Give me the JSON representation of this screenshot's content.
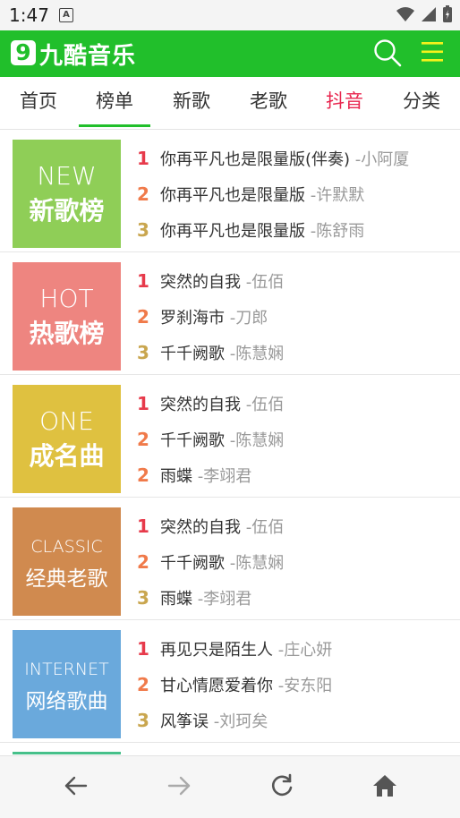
{
  "status": {
    "time": "1:47",
    "a_label": "A"
  },
  "header": {
    "logo_num": "9",
    "logo_text": "九酷音乐"
  },
  "tabs": [
    {
      "label": "首页"
    },
    {
      "label": "榜单"
    },
    {
      "label": "新歌"
    },
    {
      "label": "老歌"
    },
    {
      "label": "抖音"
    },
    {
      "label": "分类"
    }
  ],
  "charts": [
    {
      "en": "NEW",
      "cn": "新歌榜",
      "color": "#8fce57",
      "songs": [
        {
          "rank": "1",
          "title": "你再平凡也是限量版(伴奏)",
          "artist": "-小阿厦"
        },
        {
          "rank": "2",
          "title": "你再平凡也是限量版",
          "artist": "-许默默"
        },
        {
          "rank": "3",
          "title": "你再平凡也是限量版",
          "artist": "-陈舒雨"
        }
      ]
    },
    {
      "en": "HOT",
      "cn": "热歌榜",
      "color": "#ee8580",
      "songs": [
        {
          "rank": "1",
          "title": "突然的自我",
          "artist": "-伍佰"
        },
        {
          "rank": "2",
          "title": "罗刹海市",
          "artist": "-刀郎"
        },
        {
          "rank": "3",
          "title": "千千阙歌",
          "artist": "-陈慧娴"
        }
      ]
    },
    {
      "en": "ONE",
      "cn": "成名曲",
      "color": "#dfc140",
      "songs": [
        {
          "rank": "1",
          "title": "突然的自我",
          "artist": "-伍佰"
        },
        {
          "rank": "2",
          "title": "千千阙歌",
          "artist": "-陈慧娴"
        },
        {
          "rank": "2",
          "title": "雨蝶",
          "artist": "-李翊君"
        }
      ]
    },
    {
      "en": "CLASSIC",
      "cn": "经典老歌",
      "color": "#d08a4f",
      "songs": [
        {
          "rank": "1",
          "title": "突然的自我",
          "artist": "-伍佰"
        },
        {
          "rank": "2",
          "title": "千千阙歌",
          "artist": "-陈慧娴"
        },
        {
          "rank": "3",
          "title": "雨蝶",
          "artist": "-李翊君"
        }
      ]
    },
    {
      "en": "INTERNET",
      "cn": "网络歌曲",
      "color": "#6aa9dc",
      "songs": [
        {
          "rank": "1",
          "title": "再见只是陌生人",
          "artist": "-庄心妍"
        },
        {
          "rank": "2",
          "title": "甘心情愿爱着你",
          "artist": "-安东阳"
        },
        {
          "rank": "3",
          "title": "风筝误",
          "artist": "-刘珂矣"
        }
      ]
    }
  ],
  "icons": {
    "back": "arrow-left-icon",
    "forward": "arrow-right-icon",
    "refresh": "refresh-icon",
    "home": "home-icon",
    "search": "search-icon",
    "menu": "menu-icon"
  }
}
